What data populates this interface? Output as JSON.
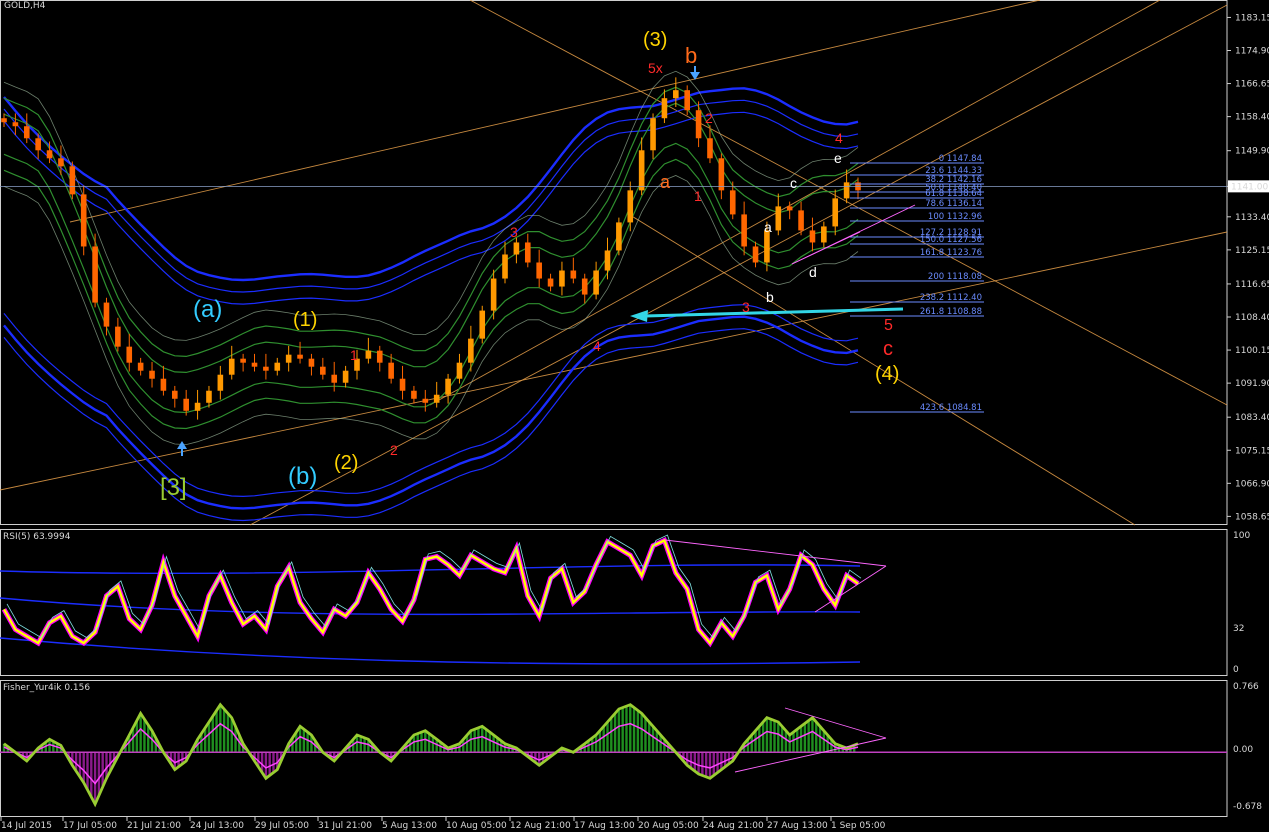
{
  "main": {
    "title": "GOLD,H4",
    "price_axis": [
      "1183.15",
      "1174.90",
      "1166.65",
      "1158.40",
      "1149.90",
      "1141.00",
      "1133.40",
      "1125.15",
      "1116.65",
      "1108.40",
      "1100.15",
      "1091.90",
      "1083.40",
      "1075.15",
      "1066.90",
      "1058.65"
    ],
    "current_price": "1141.00",
    "fib_levels": [
      "0 1147.84",
      "23.6 1144.33",
      "38.2 1142.16",
      "50.0 1140.40",
      "61.8 1138.64",
      "78.6 1136.14",
      "100 1132.96",
      "127.2 1128.91",
      "150.0 1127.56",
      "161.8 1123.76",
      "200 1118.08",
      "238.2 1112.40",
      "261.8 1108.88",
      "423.6 1084.81"
    ],
    "wave_labels": [
      "(3)",
      "b",
      "5x",
      "2",
      "a",
      "1",
      "3",
      "4",
      "3",
      "a",
      "b",
      "c",
      "d",
      "e",
      "4",
      "5",
      "c",
      "(4)",
      "(a)",
      "(1)",
      "1",
      "(b)",
      "(2)",
      "2",
      "[3]"
    ]
  },
  "rsi": {
    "title": "RSI(5) 63.9994",
    "axis": [
      "100",
      "32",
      "0"
    ]
  },
  "fisher": {
    "title": "Fisher_Yur4ik 0.156",
    "axis": [
      "0.766",
      "0.00",
      "-0.678"
    ]
  },
  "time_axis": [
    "14 Jul 2015",
    "17 Jul 05:00",
    "21 Jul 21:00",
    "24 Jul 13:00",
    "29 Jul 05:00",
    "31 Jul 21:00",
    "5 Aug 13:00",
    "10 Aug 05:00",
    "12 Aug 21:00",
    "17 Aug 13:00",
    "20 Aug 05:00",
    "24 Aug 21:00",
    "27 Aug 13:00",
    "1 Sep 05:00"
  ],
  "colors": {
    "background": "#000000",
    "bull": "#ff9900",
    "bear": "#ff6600",
    "band_blue": "#1b2dff",
    "band_green": "#2f8f2f",
    "rsi_yellow": "#ffff00",
    "rsi_magenta": "#ff00ff",
    "fisher_lime": "#9acd32",
    "hist_green": "#1f8f1f",
    "hist_purple": "#8b1a8b",
    "fib": "#6b8cff",
    "trend": "#e8a04a",
    "cyan_arrow": "#33d6e6"
  },
  "chart_data": [
    {
      "type": "line",
      "title": "GOLD,H4",
      "x_ticks": [
        "14 Jul 2015",
        "17 Jul 05:00",
        "21 Jul 21:00",
        "24 Jul 13:00",
        "29 Jul 05:00",
        "31 Jul 21:00",
        "5 Aug 13:00",
        "10 Aug 05:00",
        "12 Aug 21:00",
        "17 Aug 13:00",
        "20 Aug 05:00",
        "24 Aug 21:00",
        "27 Aug 13:00",
        "1 Sep 05:00"
      ],
      "ylim": [
        1056.5,
        1187.5
      ],
      "series": [
        {
          "values": [
            1157,
            1156,
            1153,
            1150,
            1148,
            1146,
            1139,
            1126,
            1112,
            1106,
            1101,
            1097,
            1095,
            1093,
            1090,
            1088,
            1085,
            1087,
            1090,
            1094,
            1098,
            1097,
            1096,
            1095,
            1097,
            1099,
            1098,
            1096,
            1094,
            1092,
            1095,
            1098,
            1100,
            1097,
            1093,
            1090,
            1088,
            1087,
            1089,
            1093,
            1097,
            1103,
            1110,
            1118,
            1124,
            1127,
            1122,
            1118,
            1116,
            1120,
            1118,
            1114,
            1120,
            1125,
            1132,
            1140,
            1150,
            1158,
            1163,
            1165,
            1160,
            1153,
            1148,
            1140,
            1134,
            1126,
            1122,
            1130,
            1136,
            1135,
            1130,
            1127,
            1131,
            1138,
            1142,
            1140
          ]
        }
      ]
    },
    {
      "type": "line",
      "title": "RSI(5) 63.9994",
      "ylim": [
        0,
        100
      ],
      "series": [
        {
          "values": [
            45,
            30,
            25,
            20,
            35,
            40,
            25,
            20,
            28,
            55,
            62,
            38,
            30,
            48,
            80,
            55,
            40,
            25,
            55,
            70,
            50,
            34,
            40,
            30,
            62,
            76,
            50,
            38,
            28,
            45,
            40,
            50,
            72,
            60,
            45,
            36,
            52,
            82,
            84,
            78,
            70,
            85,
            80,
            75,
            72,
            90,
            55,
            40,
            68,
            75,
            50,
            58,
            78,
            95,
            90,
            85,
            70,
            92,
            96,
            72,
            60,
            30,
            20,
            35,
            25,
            40,
            65,
            70,
            45,
            60,
            85,
            78,
            60,
            48,
            70,
            64
          ]
        }
      ]
    },
    {
      "type": "line",
      "title": "Fisher_Yur4ik 0.156",
      "ylim": [
        -0.678,
        0.766
      ],
      "series": [
        {
          "values": [
            0.1,
            0.0,
            -0.1,
            0.05,
            0.15,
            0.08,
            -0.15,
            -0.35,
            -0.6,
            -0.3,
            -0.05,
            0.2,
            0.45,
            0.25,
            0.0,
            -0.2,
            -0.1,
            0.15,
            0.35,
            0.55,
            0.4,
            0.1,
            -0.1,
            -0.3,
            -0.2,
            0.1,
            0.3,
            0.2,
            0.0,
            -0.1,
            0.05,
            0.2,
            0.15,
            0.0,
            -0.1,
            0.05,
            0.2,
            0.25,
            0.15,
            0.05,
            0.1,
            0.25,
            0.3,
            0.2,
            0.1,
            0.05,
            -0.05,
            -0.15,
            -0.05,
            0.05,
            0.0,
            0.1,
            0.2,
            0.35,
            0.5,
            0.55,
            0.45,
            0.3,
            0.15,
            0.0,
            -0.15,
            -0.25,
            -0.3,
            -0.2,
            -0.1,
            0.1,
            0.25,
            0.4,
            0.35,
            0.2,
            0.3,
            0.4,
            0.25,
            0.1,
            0.05,
            0.1
          ]
        }
      ]
    }
  ]
}
